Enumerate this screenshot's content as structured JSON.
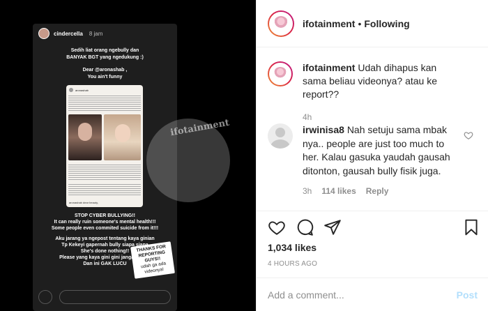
{
  "story": {
    "username": "cindercella",
    "time": "8 jam",
    "line1": "Sedih liat orang ngebully dan",
    "line2": "BANYAK BGT yang ngedukung :)",
    "line3": "Dear @aronashab ,",
    "line4": "You ain't funny",
    "card_user": "aronashab",
    "card_footer": "aronashab dear beauty,",
    "msg1": "STOP CYBER BULLYING!!",
    "msg2": "It can really ruin someone's mental health!!!",
    "msg3": "Some people even commited suicide from it!!!",
    "msg4": "Aku jarang ya ngepost tentang kaya ginian",
    "msg5": "Tp Kekeyi gapernah bully siapa siapa",
    "msg6": "She's done nothing!!",
    "msg7": "Please yang kaya gini gini jangan ditiru",
    "msg8": "Dan ini GAK LUCU",
    "sticker1": "THANKS FOR REPORTING GUYS!!",
    "sticker2": "udah ga ada videonya!",
    "watermark": "ifotainment"
  },
  "header": {
    "username": "ifotainment",
    "separator": "•",
    "follow_state": "Following"
  },
  "caption": {
    "username": "ifotainment",
    "text": "Udah dihapus kan sama beliau videonya? atau ke report??",
    "time": "4h"
  },
  "comment": {
    "username": "irwinisa8",
    "text": "Nah setuju sama mbak nya.. people are just too much to her. Kalau gasuka yaudah gausah ditonton, gausah bully fisik juga.",
    "time": "3h",
    "likes": "114 likes",
    "reply": "Reply"
  },
  "post": {
    "likes": "1,034 likes",
    "time": "4 HOURS AGO"
  },
  "add_comment": {
    "placeholder": "Add a comment...",
    "post_label": "Post"
  },
  "colors": {
    "accent": "#0095f6",
    "post_disabled": "#b2dffc",
    "muted": "#8e8e8e"
  }
}
